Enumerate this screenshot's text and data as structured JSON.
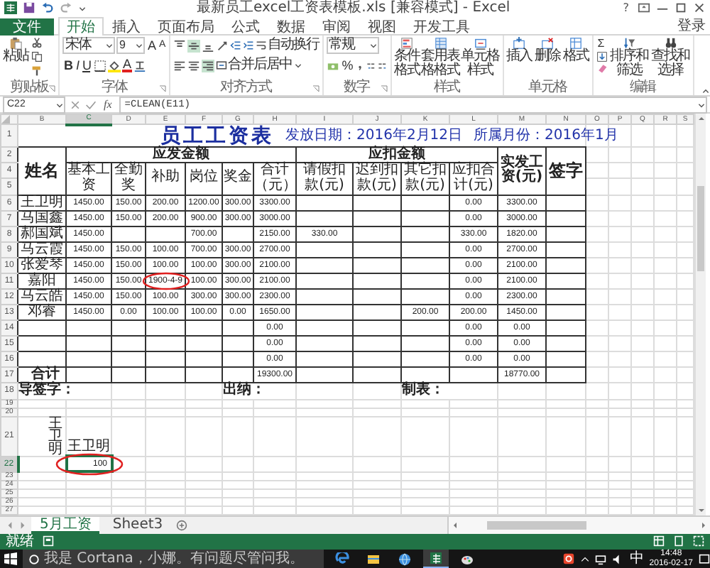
{
  "window": {
    "title": "最新员工excel工资表模板.xls [兼容模式] - Excel",
    "help": "?"
  },
  "ribbon_tabs": [
    {
      "label": "文件",
      "kind": "file",
      "selected": false
    },
    {
      "label": "开始",
      "kind": "tab",
      "selected": true
    },
    {
      "label": "插入",
      "kind": "tab",
      "selected": false
    },
    {
      "label": "页面布局",
      "kind": "tab",
      "selected": false
    },
    {
      "label": "公式",
      "kind": "tab",
      "selected": false
    },
    {
      "label": "数据",
      "kind": "tab",
      "selected": false
    },
    {
      "label": "审阅",
      "kind": "tab",
      "selected": false
    },
    {
      "label": "视图",
      "kind": "tab",
      "selected": false
    },
    {
      "label": "开发工具",
      "kind": "tab",
      "selected": false
    }
  ],
  "account": "登录",
  "ribbon": {
    "groups": [
      {
        "kind": "clipboard",
        "label": "剪贴板",
        "launcher": true,
        "paste": "粘贴"
      },
      {
        "kind": "font",
        "label": "字体",
        "launcher": true,
        "font_name": "宋体",
        "font_size": "9",
        "grow": "A",
        "shrink": "A",
        "bold": "B",
        "italic": "I",
        "underline": "U",
        "font_color": "A"
      },
      {
        "kind": "alignment",
        "label": "对齐方式",
        "launcher": true,
        "vertical_align": [
          {
            "kind": "top",
            "selected": false
          },
          {
            "kind": "middle",
            "selected": true
          },
          {
            "kind": "bottom",
            "selected": false
          }
        ],
        "horizontal_align": [
          {
            "kind": "left",
            "selected": false
          },
          {
            "kind": "center",
            "selected": false
          },
          {
            "kind": "right",
            "selected": true
          }
        ],
        "wrap": "自动换行",
        "merge": "合并后居中"
      },
      {
        "kind": "number",
        "label": "数字",
        "launcher": true,
        "format": "常规",
        "percent": "%"
      },
      {
        "kind": "styles",
        "label": "样式",
        "launcher": false,
        "buttons": [
          "条件格式",
          "套用表格格式",
          "单元格样式"
        ]
      },
      {
        "kind": "cells",
        "label": "单元格",
        "launcher": false,
        "buttons": [
          "插入",
          "删除",
          "格式"
        ]
      },
      {
        "kind": "editing",
        "label": "编辑",
        "launcher": false,
        "sum": "Σ",
        "buttons": [
          "排序和筛选",
          "查找和选择"
        ]
      }
    ]
  },
  "formula_bar": {
    "name_box": "C22",
    "fx": "fx",
    "formula": "=CLEAN(E11)"
  },
  "columns": [
    {
      "label": "B",
      "selected": false
    },
    {
      "label": "C",
      "selected": true
    },
    {
      "label": "D",
      "selected": false
    },
    {
      "label": "E",
      "selected": false
    },
    {
      "label": "F",
      "selected": false
    },
    {
      "label": "G",
      "selected": false
    },
    {
      "label": "H",
      "selected": false
    },
    {
      "label": "I",
      "selected": false
    },
    {
      "label": "J",
      "selected": false
    },
    {
      "label": "K",
      "selected": false
    },
    {
      "label": "L",
      "selected": false
    },
    {
      "label": "M",
      "selected": false
    },
    {
      "label": "N",
      "selected": false
    },
    {
      "label": "O",
      "selected": false
    },
    {
      "label": "P",
      "selected": false
    },
    {
      "label": "Q",
      "selected": false
    },
    {
      "label": "R",
      "selected": false
    },
    {
      "label": "S",
      "selected": false
    }
  ],
  "row_numbers": [
    {
      "label": "1",
      "selected": false
    },
    {
      "label": "2",
      "selected": false
    },
    {
      "label": "4",
      "selected": false
    },
    {
      "label": "5",
      "selected": false
    },
    {
      "label": "6",
      "selected": false
    },
    {
      "label": "7",
      "selected": false
    },
    {
      "label": "8",
      "selected": false
    },
    {
      "label": "9",
      "selected": false
    },
    {
      "label": "10",
      "selected": false
    },
    {
      "label": "11",
      "selected": false
    },
    {
      "label": "12",
      "selected": false
    },
    {
      "label": "13",
      "selected": false
    },
    {
      "label": "14",
      "selected": false
    },
    {
      "label": "15",
      "selected": false
    },
    {
      "label": "16",
      "selected": false
    },
    {
      "label": "17",
      "selected": false
    },
    {
      "label": "18",
      "selected": false
    },
    {
      "label": "19",
      "selected": false
    },
    {
      "label": "20",
      "selected": false
    },
    {
      "label": "21",
      "selected": false
    },
    {
      "label": "22",
      "selected": true
    },
    {
      "label": "23",
      "selected": false
    },
    {
      "label": "24",
      "selected": false
    },
    {
      "label": "25",
      "selected": false
    },
    {
      "label": "26",
      "selected": false
    },
    {
      "label": "27",
      "selected": false
    }
  ],
  "sheet_title": "员工工资表",
  "issue_date": "发放日期：2016年2月12日",
  "pay_month": "所属月份：2016年1月",
  "table": {
    "name_header": "姓名",
    "payable_header": "应发金额",
    "deduction_header": "应扣金额",
    "net_header": "实发工资(元)",
    "sign_header": "签字",
    "column_headers": [
      "基本工资",
      "全勤奖",
      "补助",
      "岗位",
      "奖金",
      "合计（元）",
      "请假扣款(元)",
      "迟到扣款(元)",
      "其它扣款(元)",
      "应扣合计(元)"
    ],
    "rows": [
      {
        "name": "王卫明",
        "cells": [
          "1450.00",
          "150.00",
          "200.00",
          "1200.00",
          "300.00",
          "3300.00",
          null,
          null,
          null,
          "0.00",
          "3300.00"
        ]
      },
      {
        "name": "马国鑫",
        "cells": [
          "1450.00",
          "150.00",
          "200.00",
          "900.00",
          "300.00",
          "3000.00",
          null,
          null,
          null,
          "0.00",
          "3000.00"
        ]
      },
      {
        "name": "郝国斌",
        "cells": [
          "1450.00",
          null,
          null,
          "700.00",
          null,
          "2150.00",
          "330.00",
          null,
          null,
          "330.00",
          "1820.00"
        ]
      },
      {
        "name": "马云霞",
        "cells": [
          "1450.00",
          "150.00",
          "100.00",
          "700.00",
          "300.00",
          "2700.00",
          null,
          null,
          null,
          "0.00",
          "2700.00"
        ]
      },
      {
        "name": "张爱琴",
        "cells": [
          "1450.00",
          "150.00",
          "100.00",
          "100.00",
          "300.00",
          "2100.00",
          null,
          null,
          null,
          "0.00",
          "2100.00"
        ]
      },
      {
        "name": "嘉阳",
        "cells": [
          "1450.00",
          "150.00",
          {
            "value": "1900-4-9",
            "circled": true
          },
          "100.00",
          "300.00",
          "2100.00",
          null,
          null,
          null,
          "0.00",
          "2100.00"
        ]
      },
      {
        "name": "马云皓",
        "cells": [
          "1450.00",
          "150.00",
          "100.00",
          "300.00",
          "300.00",
          "2300.00",
          null,
          null,
          null,
          "0.00",
          "2300.00"
        ]
      },
      {
        "name": "邓睿",
        "cells": [
          "1450.00",
          "0.00",
          "100.00",
          "100.00",
          "0.00",
          "1650.00",
          null,
          null,
          "200.00",
          "200.00",
          "1450.00"
        ]
      },
      {
        "cells": [
          null,
          null,
          null,
          null,
          null,
          "0.00",
          null,
          null,
          null,
          "0.00",
          "0.00"
        ]
      },
      {
        "cells": [
          null,
          null,
          null,
          null,
          null,
          "0.00",
          null,
          null,
          null,
          "0.00",
          "0.00"
        ]
      },
      {
        "cells": [
          null,
          null,
          null,
          null,
          null,
          "0.00",
          null,
          null,
          null,
          "0.00",
          "0.00"
        ]
      }
    ],
    "total_row": {
      "label": "合计",
      "cells": [
        null,
        null,
        null,
        null,
        null,
        "19300.00",
        null,
        null,
        null,
        null,
        "18770.00"
      ]
    }
  },
  "signatures": [
    "导签字：",
    "出纳：",
    "制表："
  ],
  "copy_area": {
    "vertical_name": "王卫明",
    "name": "王卫明",
    "value": {
      "value": "100",
      "circled": true,
      "selected": true
    }
  },
  "sheet_tabs": [
    {
      "label": "5月工资",
      "selected": true
    },
    {
      "label": "Sheet3",
      "selected": false
    }
  ],
  "status": "就绪",
  "taskbar": {
    "search": {
      "placeholder": "我是 Cortana，小娜。有问题尽管问我。"
    },
    "apps": [
      {
        "kind": "edge",
        "active": false
      },
      {
        "kind": "explorer",
        "active": false
      },
      {
        "kind": "browser",
        "active": false
      },
      {
        "kind": "excel",
        "active": true
      },
      {
        "kind": "paint",
        "active": false
      }
    ],
    "ime": "中",
    "time": "14:48",
    "date": "2016-02-17"
  }
}
